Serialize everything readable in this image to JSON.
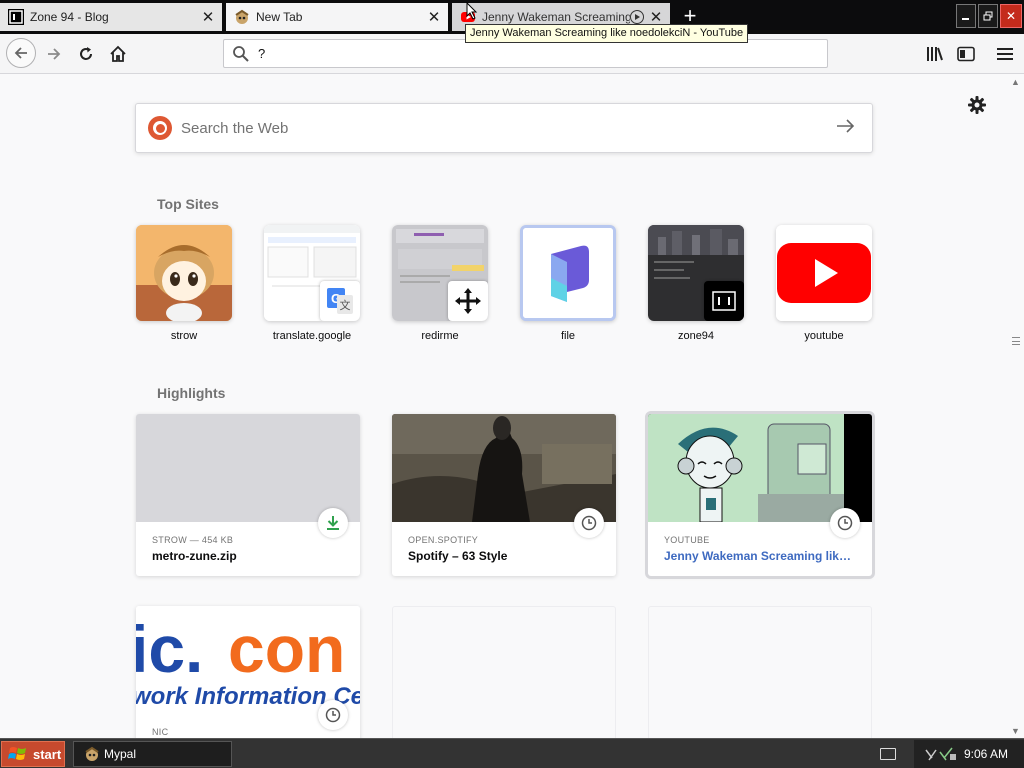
{
  "tabs": [
    {
      "title": "Zone 94 - Blog",
      "favicon": "zone94-favicon",
      "state": "inactive"
    },
    {
      "title": "New Tab",
      "favicon": "strow-favicon",
      "state": "selected"
    },
    {
      "title": "Jenny Wakeman Screaming like noedolekciN - YouTube",
      "favicon": "youtube-favicon",
      "state": "playing"
    }
  ],
  "tooltip": "Jenny Wakeman Screaming like noedolekciN - YouTube",
  "toolbar": {
    "url_value": "?",
    "window_buttons": [
      "minimize-icon",
      "restore-icon",
      "close-icon"
    ]
  },
  "search": {
    "placeholder": "Search the Web",
    "engine": "duckduckgo"
  },
  "top_sites": {
    "title": "Top Sites",
    "items": [
      {
        "label": "strow"
      },
      {
        "label": "translate.google"
      },
      {
        "label": "redirme"
      },
      {
        "label": "file"
      },
      {
        "label": "zone94"
      },
      {
        "label": "youtube"
      }
    ]
  },
  "highlights": {
    "title": "Highlights",
    "cards": [
      {
        "source": "STROW — 454 KB",
        "title": "metro-zune.zip",
        "badge": "download-icon"
      },
      {
        "source": "OPEN.SPOTIFY",
        "title": "Spotify – 63 Style",
        "badge": "clock-icon"
      },
      {
        "source": "YOUTUBE",
        "title": "Jenny Wakeman Screaming like ...",
        "badge": "clock-icon"
      },
      {
        "source": "NIC",
        "title": "",
        "badge": "clock-icon"
      }
    ]
  },
  "taskbar": {
    "start_label": "start",
    "items": [
      {
        "label": "Mypal"
      }
    ],
    "clock": "9:06 AM"
  },
  "colors": {
    "accent_link": "#3e6ac0",
    "download_green": "#30a14e",
    "start_button": "#c64a2e",
    "youtube_red": "#ff0000",
    "ddg_orange": "#de5833"
  }
}
